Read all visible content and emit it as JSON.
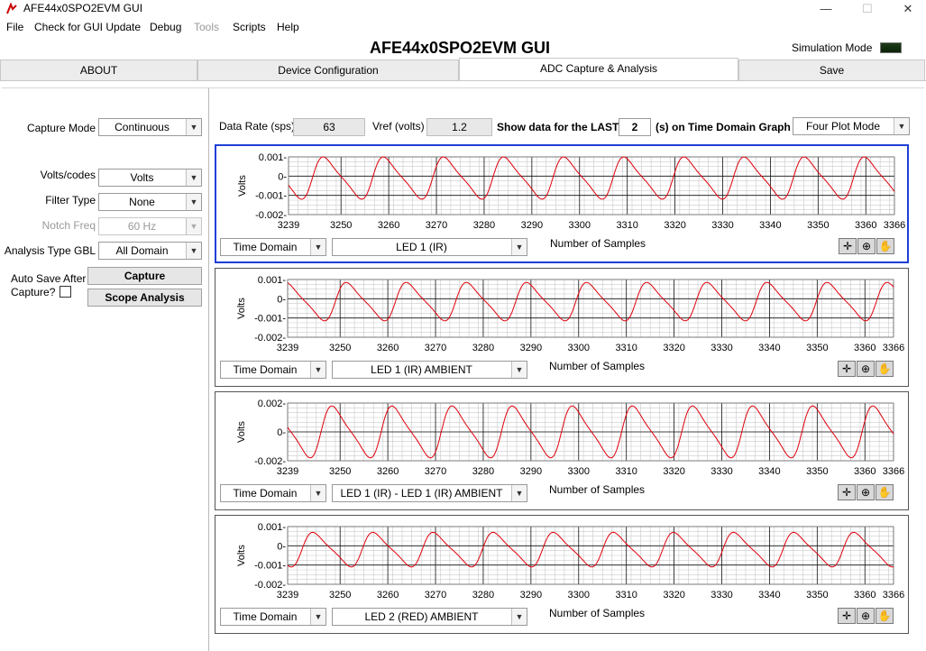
{
  "window": {
    "title": "AFE44x0SPO2EVM GUI",
    "minimize_glyph": "—",
    "maximize_glyph": "☐",
    "close_glyph": "✕"
  },
  "menu": [
    "File",
    "Check for GUI Update",
    "Debug",
    "Tools",
    "Scripts",
    "Help"
  ],
  "header": {
    "title": "AFE44x0SPO2EVM GUI",
    "sim_label": "Simulation Mode"
  },
  "tabs": [
    {
      "label": "ABOUT"
    },
    {
      "label": "Device Configuration"
    },
    {
      "label": "ADC Capture & Analysis"
    },
    {
      "label": "Save"
    }
  ],
  "left_panel": {
    "capture_mode_label": "Capture Mode",
    "capture_mode_value": "Continuous",
    "volts_codes_label": "Volts/codes",
    "volts_codes_value": "Volts",
    "filter_type_label": "Filter Type",
    "filter_type_value": "None",
    "notch_freq_label": "Notch Freq",
    "notch_freq_value": "60 Hz",
    "analysis_type_label": "Analysis Type GBL",
    "analysis_type_value": "All Domain",
    "auto_save_label_1": "Auto Save After",
    "auto_save_label_2": "Capture?",
    "capture_button": "Capture",
    "scope_button": "Scope Analysis"
  },
  "top_row": {
    "data_rate_label": "Data Rate (sps)",
    "data_rate_value": "63",
    "vref_label": "Vref (volts)",
    "vref_value": "1.2",
    "show_label": "Show data for the LAST",
    "show_value": "2",
    "show_suffix": "(s) on Time Domain Graph",
    "plot_mode_value": "Four Plot Mode"
  },
  "graphs": [
    {
      "domain": "Time Domain",
      "signal": "LED 1 (IR)",
      "chart_data": {
        "type": "line",
        "ylabel": "Volts",
        "xlabel": "Number of Samples",
        "xlim": [
          3239,
          3366
        ],
        "ylim": [
          -0.002,
          0.001
        ],
        "xticks": [
          "3239",
          "3250",
          "3260",
          "3270",
          "3280",
          "3290",
          "3300",
          "3310",
          "3320",
          "3330",
          "3340",
          "3350",
          "3360",
          "3366"
        ],
        "yticks": [
          "0.001-",
          "0-",
          "-0.001-",
          "-0.002-"
        ],
        "series": [
          {
            "period": 12.6,
            "phase": 3244,
            "amplitude": 0.0011,
            "offset": -0.0001
          }
        ]
      }
    },
    {
      "domain": "Time Domain",
      "signal": "LED 1 (IR) AMBIENT",
      "chart_data": {
        "type": "line",
        "ylabel": "Volts",
        "xlabel": "Number of Samples",
        "xlim": [
          3239,
          3366
        ],
        "ylim": [
          -0.002,
          0.001
        ],
        "xticks": [
          "3239",
          "3250",
          "3260",
          "3270",
          "3280",
          "3290",
          "3300",
          "3310",
          "3320",
          "3330",
          "3340",
          "3350",
          "3360",
          "3366"
        ],
        "yticks": [
          "0.001-",
          "0-",
          "-0.001-",
          "-0.002-"
        ],
        "series": [
          {
            "period": 12.6,
            "phase": 3249,
            "amplitude": 0.001,
            "offset": -0.00015
          }
        ]
      }
    },
    {
      "domain": "Time Domain",
      "signal": "LED 1 (IR) - LED 1 (IR) AMBIENT",
      "chart_data": {
        "type": "line",
        "ylabel": "Volts",
        "xlabel": "Number of Samples",
        "xlim": [
          3239,
          3366
        ],
        "ylim": [
          -0.002,
          0.002
        ],
        "xticks": [
          "3239",
          "3250",
          "3260",
          "3270",
          "3280",
          "3290",
          "3300",
          "3310",
          "3320",
          "3330",
          "3340",
          "3350",
          "3360",
          "3366"
        ],
        "yticks": [
          "0.002-",
          "0-",
          "-0.002-"
        ],
        "series": [
          {
            "period": 12.6,
            "phase": 3246,
            "amplitude": 0.0018,
            "offset": 0.0
          }
        ]
      }
    },
    {
      "domain": "Time Domain",
      "signal": "LED 2 (RED) AMBIENT",
      "chart_data": {
        "type": "line",
        "ylabel": "Volts",
        "xlabel": "Number of Samples",
        "xlim": [
          3239,
          3366
        ],
        "ylim": [
          -0.002,
          0.001
        ],
        "xticks": [
          "3239",
          "3250",
          "3260",
          "3270",
          "3280",
          "3290",
          "3300",
          "3310",
          "3320",
          "3330",
          "3340",
          "3350",
          "3360",
          "3366"
        ],
        "yticks": [
          "0.001-",
          "0-",
          "-0.001-",
          "-0.002-"
        ],
        "series": [
          {
            "period": 12.6,
            "phase": 3242,
            "amplitude": 0.0009,
            "offset": -0.0002
          }
        ]
      }
    }
  ],
  "tools": {
    "cursor_glyph": "✛",
    "zoom_glyph": "⊕",
    "pan_glyph": "✋"
  },
  "colors": {
    "trace": "#e0000c",
    "selected_border": "#1f3fd6",
    "grid": "#c9c9c9",
    "sim_led": "#1d3b18"
  }
}
